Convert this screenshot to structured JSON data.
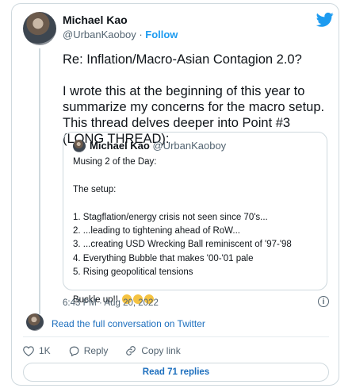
{
  "author": {
    "name": "Michael Kao",
    "handle": "@UrbanKaoboy",
    "separator": " · ",
    "follow_label": "Follow"
  },
  "tweet": {
    "text": "Re: Inflation/Macro-Asian Contagion 2.0?\n\nI wrote this at the beginning of this year to summarize my concerns for the macro setup. This thread delves deeper into Point #3 (LONG THREAD):"
  },
  "quoted_tweet": {
    "name": "Michael Kao",
    "handle": "@UrbanKaoboy",
    "text": "Musing 2 of the Day:\n\nThe setup:\n\n1. Stagflation/energy crisis not seen since 70's...\n2. ...leading to tightening ahead of RoW...\n3. ...creating USD Wrecking Ball reminiscent of '97-'98\n4. Everything Bubble that makes '00-'01 pale\n5. Rising geopolitical tensions\n\nBuckle up!!",
    "emojis": [
      "grimacing-face",
      "grimacing-face",
      "grimacing-face"
    ]
  },
  "timestamp": "6:43 PM · Aug 20, 2022",
  "info_icon": "i",
  "full_conversation_label": "Read the full conversation on Twitter",
  "actions": {
    "like_count": "1K",
    "reply_label": "Reply",
    "copy_link_label": "Copy link"
  },
  "read_replies_label": "Read 71 replies",
  "colors": {
    "twitter_blue": "#1d9bf0",
    "link_blue": "#1d6fbe",
    "muted": "#536471",
    "border": "#cfd9de"
  }
}
